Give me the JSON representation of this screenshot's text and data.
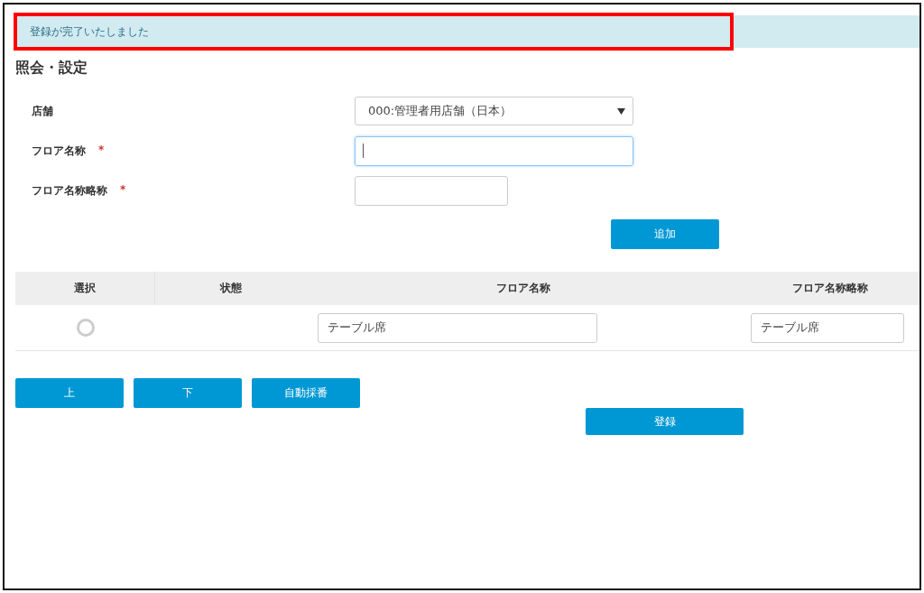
{
  "alert": {
    "text": "登録が完了いたしました",
    "highlighted": true
  },
  "title": "照会・設定",
  "form": {
    "fields": [
      {
        "kind": "select",
        "label": "店舗",
        "value": "000:管理者用店舗（日本）"
      },
      {
        "kind": "text",
        "label": "フロア名称",
        "required_mark": "*",
        "focused": true
      },
      {
        "kind": "short",
        "label": "フロア名称略称",
        "required_mark": "*",
        "focused": false
      }
    ],
    "add_button": "追加"
  },
  "table": {
    "columns": [
      "選択",
      "状態",
      "フロア名称",
      "フロア名称略称"
    ],
    "rows": [
      {
        "selected": false,
        "name": "テーブル席",
        "short_name": "テーブル席"
      }
    ]
  },
  "buttons": [
    "上",
    "下",
    "自動採番"
  ],
  "register_button": "登録"
}
